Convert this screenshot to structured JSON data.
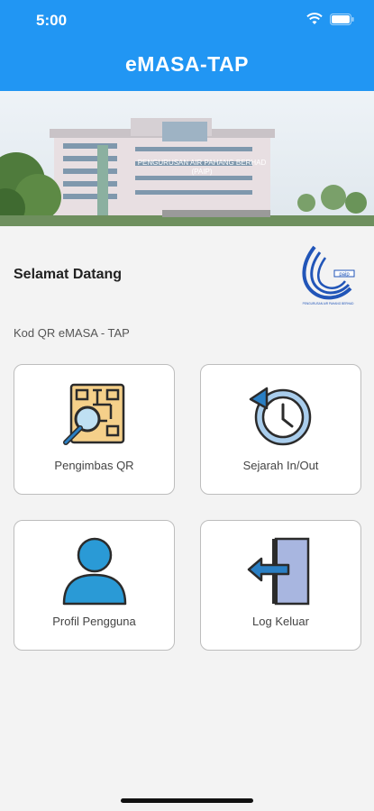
{
  "status_bar": {
    "time": "5:00"
  },
  "header": {
    "title": "eMASA-TAP"
  },
  "banner": {
    "building_sign": "PENGURUSAN AIR PAHANG BERHAD",
    "building_sign_abbr": "(PAIP)"
  },
  "welcome": {
    "text": "Selamat Datang"
  },
  "logo": {
    "caption": "PENGURUSAN AIR PAHANG BERHAD"
  },
  "section": {
    "qr_label": "Kod QR eMASA - TAP"
  },
  "menu": [
    {
      "label": "Pengimbas QR",
      "icon": "qr-scanner-icon"
    },
    {
      "label": "Sejarah In/Out",
      "icon": "history-icon"
    },
    {
      "label": "Profil Pengguna",
      "icon": "user-profile-icon"
    },
    {
      "label": "Log Keluar",
      "icon": "logout-icon"
    }
  ],
  "colors": {
    "primary": "#2196f3",
    "background": "#f3f3f3",
    "tile_border": "#bdbdbd"
  }
}
